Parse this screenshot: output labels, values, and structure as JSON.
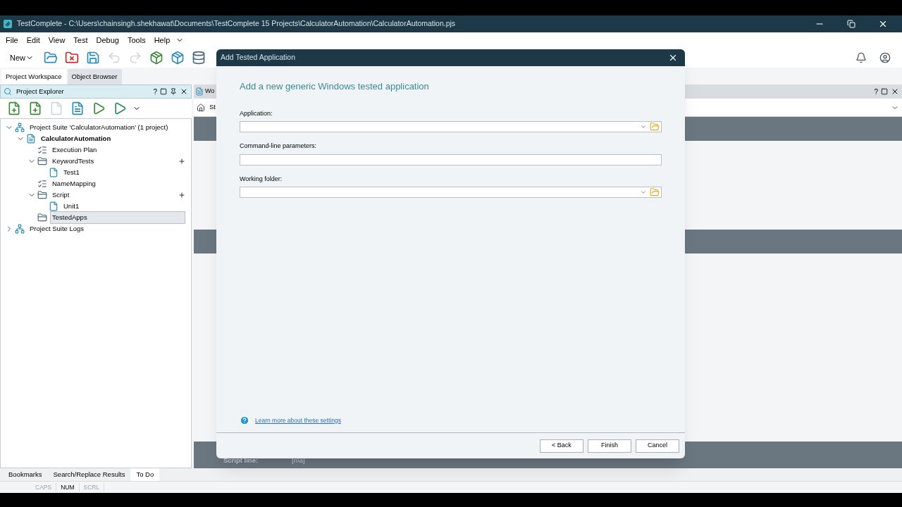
{
  "window": {
    "title": "TestComplete - C:\\Users\\chainsingh.shekhawat\\Documents\\TestComplete 15 Projects\\CalculatorAutomation\\CalculatorAutomation.pjs"
  },
  "menu": [
    "File",
    "Edit",
    "View",
    "Test",
    "Debug",
    "Tools",
    "Help"
  ],
  "toolbar": {
    "new_label": "New"
  },
  "workspace_tabs": [
    {
      "label": "Project Workspace",
      "selected": true
    },
    {
      "label": "Object Browser",
      "selected": false
    }
  ],
  "explorer": {
    "title": "Project Explorer",
    "help": "?",
    "tree": [
      {
        "label": "Project Suite 'CalculatorAutomation' (1 project)",
        "kind": "suite",
        "expanded": true,
        "selected": false,
        "has_add": false,
        "children": [
          {
            "label": "CalculatorAutomation",
            "kind": "project",
            "expanded": true,
            "selected": false,
            "has_add": false,
            "children": [
              {
                "label": "Execution Plan",
                "kind": "plan",
                "selected": false,
                "has_add": false
              },
              {
                "label": "KeywordTests",
                "kind": "folder",
                "expanded": true,
                "selected": false,
                "has_add": true,
                "children": [
                  {
                    "label": "Test1",
                    "kind": "file",
                    "selected": false,
                    "has_add": false
                  }
                ]
              },
              {
                "label": "NameMapping",
                "kind": "plan",
                "selected": false,
                "has_add": false
              },
              {
                "label": "Script",
                "kind": "folder",
                "expanded": true,
                "selected": false,
                "has_add": true,
                "children": [
                  {
                    "label": "Unit1",
                    "kind": "file",
                    "selected": false,
                    "has_add": false
                  }
                ]
              },
              {
                "label": "TestedApps",
                "kind": "folder",
                "selected": true,
                "has_add": false
              }
            ]
          }
        ]
      },
      {
        "label": "Project Suite Logs",
        "kind": "suite",
        "expanded": false,
        "selected": false,
        "has_add": false
      }
    ]
  },
  "editor": {
    "tab_label": "Wo",
    "breadcrumb": "St",
    "help": "?",
    "script_line_label": "Script line:",
    "script_line_value": "[n\\a]"
  },
  "bottom_tabs": [
    {
      "label": "Bookmarks",
      "selected": false
    },
    {
      "label": "Search/Replace Results",
      "selected": false
    },
    {
      "label": "To Do",
      "selected": true
    }
  ],
  "status_bar": [
    {
      "label": "CAPS",
      "on": false
    },
    {
      "label": "NUM",
      "on": true
    },
    {
      "label": "SCRL",
      "on": false
    }
  ],
  "dialog": {
    "title": "Add Tested Application",
    "heading": "Add a new generic Windows tested application",
    "fields": [
      {
        "label": "Application:",
        "kind": "combo"
      },
      {
        "label": "Command-line parameters:",
        "kind": "text"
      },
      {
        "label": "Working folder:",
        "kind": "combo"
      }
    ],
    "help_link": "Learn more about these settings",
    "buttons": [
      "< Back",
      "Finish",
      "Cancel"
    ]
  }
}
